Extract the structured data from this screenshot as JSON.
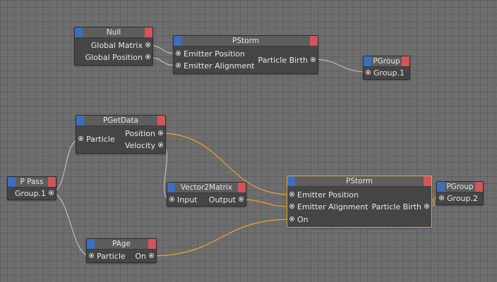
{
  "colors": {
    "canvas": "#6e6e6e",
    "node_body": "#454545",
    "node_header": "#5d5d5d",
    "input_cap": "#3d6ebd",
    "output_cap": "#d2555a",
    "wire_default": "#bdbdbd",
    "wire_selected": "#f0a52a"
  },
  "nodes": {
    "null1": {
      "title": "Null",
      "outputs": [
        "Global Matrix",
        "Global Position"
      ]
    },
    "pstorm1": {
      "title": "PStorm",
      "inputs": [
        "Emitter Position",
        "Emitter Alignment"
      ],
      "outputs": [
        "Particle Birth"
      ]
    },
    "pgroup1": {
      "title": "PGroup",
      "inputs": [
        "Group.1"
      ]
    },
    "pgetdata": {
      "title": "PGetData",
      "inputs": [
        "Particle"
      ],
      "outputs": [
        "Position",
        "Velocity"
      ]
    },
    "ppass": {
      "title": "P Pass",
      "outputs": [
        "Group.1"
      ]
    },
    "vector2matrix": {
      "title": "Vector2Matrix",
      "inputs": [
        "Input"
      ],
      "outputs": [
        "Output"
      ]
    },
    "pstorm2": {
      "title": "PStorm",
      "inputs": [
        "Emitter Position",
        "Emitter Alignment",
        "On"
      ],
      "outputs": [
        "Particle Birth"
      ]
    },
    "pgroup2": {
      "title": "PGroup",
      "inputs": [
        "Group.2"
      ]
    },
    "page": {
      "title": "PAge",
      "inputs": [
        "Particle"
      ],
      "outputs": [
        "On"
      ]
    }
  }
}
